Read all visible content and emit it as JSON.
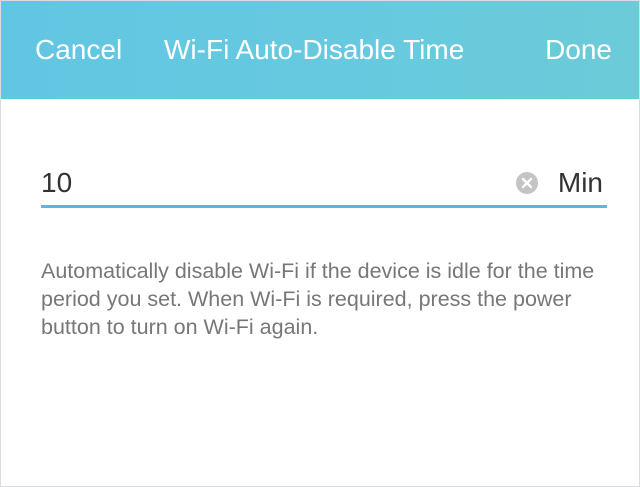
{
  "navbar": {
    "cancel_label": "Cancel",
    "title": "Wi-Fi Auto-Disable Time",
    "done_label": "Done",
    "background_color": "#66c9e0"
  },
  "field": {
    "value": "10",
    "unit": "Min",
    "clear_icon": "clear-circle-x-icon",
    "underline_color": "#4fbfd6"
  },
  "description": "Automatically disable Wi-Fi if the device is idle for the time period you set. When Wi-Fi is required, press the power button to turn on Wi-Fi again."
}
